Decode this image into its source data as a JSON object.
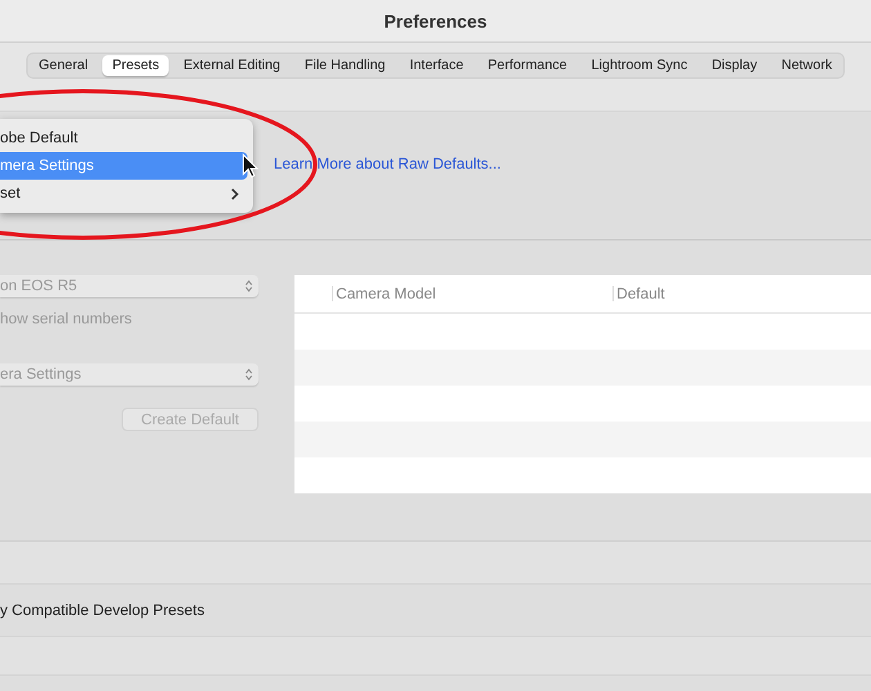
{
  "window": {
    "title": "Preferences"
  },
  "tabs": [
    {
      "label": "General",
      "selected": false
    },
    {
      "label": "Presets",
      "selected": true
    },
    {
      "label": "External Editing",
      "selected": false
    },
    {
      "label": "File Handling",
      "selected": false
    },
    {
      "label": "Interface",
      "selected": false
    },
    {
      "label": "Performance",
      "selected": false
    },
    {
      "label": "Lightroom Sync",
      "selected": false
    },
    {
      "label": "Display",
      "selected": false
    },
    {
      "label": "Network",
      "selected": false
    }
  ],
  "raw_defaults": {
    "menu": [
      {
        "label": "obe Default",
        "selected": false,
        "submenu": false
      },
      {
        "label": "mera Settings",
        "selected": true,
        "submenu": false
      },
      {
        "label": "set",
        "selected": false,
        "submenu": true
      }
    ],
    "link": "Learn More about Raw Defaults..."
  },
  "camera": {
    "model_select": "on EOS R5",
    "show_serial": {
      "label": "how serial numbers"
    },
    "default_select": "era Settings",
    "button": "Create Default",
    "table": {
      "columns": [
        "Camera Model",
        "Default"
      ]
    }
  },
  "develop": {
    "label": "y Compatible Develop Presets"
  }
}
